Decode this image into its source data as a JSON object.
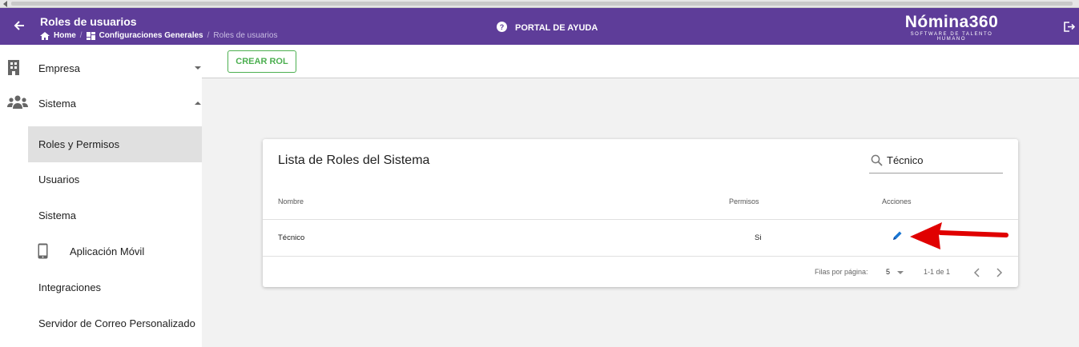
{
  "header": {
    "title": "Roles de usuarios",
    "breadcrumbs": [
      "Home",
      "Configuraciones Generales",
      "Roles de usuarios"
    ],
    "help_label": "PORTAL DE AYUDA",
    "logo_name": "Nómina360",
    "logo_tagline": "SOFTWARE DE TALENTO HUMANO"
  },
  "sidebar": {
    "items": [
      {
        "label": "Empresa",
        "icon": "building-icon",
        "expanded": false
      },
      {
        "label": "Sistema",
        "icon": "group-icon",
        "expanded": true
      }
    ],
    "sub_items": [
      {
        "label": "Roles y Permisos",
        "active": true
      },
      {
        "label": "Usuarios"
      },
      {
        "label": "Sistema"
      },
      {
        "label": "Aplicación Móvil",
        "icon": "mobile-icon"
      },
      {
        "label": "Integraciones"
      },
      {
        "label": "Servidor de Correo Personalizado"
      }
    ]
  },
  "toolbar": {
    "create_label": "CREAR ROL"
  },
  "card": {
    "title": "Lista de Roles del Sistema",
    "search_value": "Técnico",
    "columns": [
      "Nombre",
      "Permisos",
      "Acciones"
    ],
    "rows": [
      {
        "nombre": "Técnico",
        "permisos": "Si"
      }
    ],
    "rows_per_page_label": "Filas por página:",
    "rows_per_page": "5",
    "range": "1-1 de 1"
  },
  "colors": {
    "header": "#5e3d99",
    "accent_green": "#4caf50",
    "edit_blue": "#1976d2",
    "arrow_red": "#e00000"
  }
}
